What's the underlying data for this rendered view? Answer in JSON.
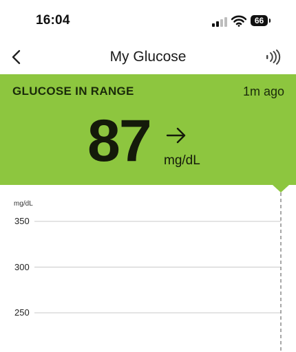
{
  "status_bar": {
    "time": "16:04",
    "battery": "66",
    "signal_icon": "cellular-signal-icon",
    "wifi_icon": "wifi-icon",
    "battery_icon": "battery-icon"
  },
  "nav": {
    "title": "My Glucose",
    "back_icon": "chevron-left-icon",
    "right_icon": "nfc-scan-icon"
  },
  "glucose": {
    "status": "GLUCOSE IN RANGE",
    "updated": "1m ago",
    "value": "87",
    "unit": "mg/dL",
    "trend_icon": "arrow-right-icon",
    "status_color": "#8dc63f"
  },
  "chart_data": {
    "type": "line",
    "ylabel": "mg/dL",
    "y_ticks": [
      350,
      300,
      250
    ],
    "series": [],
    "grid": true
  }
}
